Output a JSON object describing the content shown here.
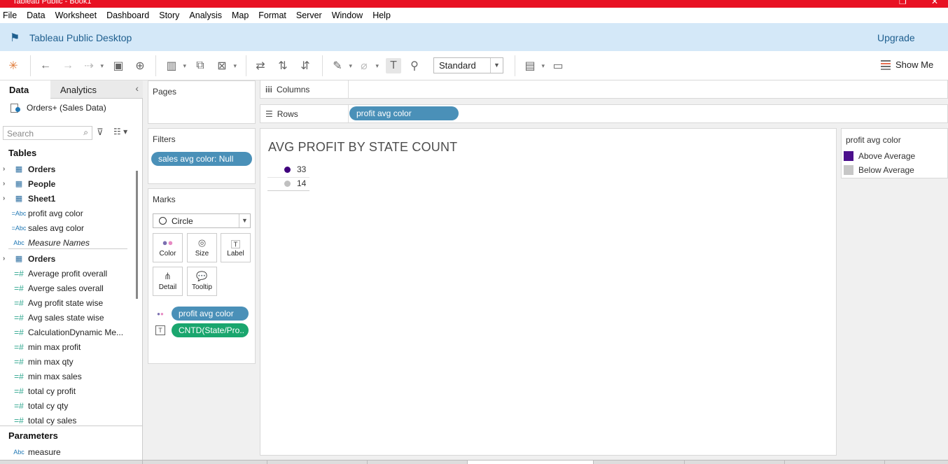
{
  "window": {
    "title": "Tableau Public - Book1"
  },
  "menu": [
    "File",
    "Data",
    "Worksheet",
    "Dashboard",
    "Story",
    "Analysis",
    "Map",
    "Format",
    "Server",
    "Window",
    "Help"
  ],
  "brand": {
    "name": "Tableau Public Desktop",
    "upgrade": "Upgrade"
  },
  "toolbar": {
    "fit_value": "Standard",
    "show_me": "Show Me"
  },
  "data_pane": {
    "tab_data": "Data",
    "tab_analytics": "Analytics",
    "datasource": "Orders+ (Sales Data)",
    "search_placeholder": "Search",
    "tables_heading": "Tables",
    "parameters_heading": "Parameters",
    "items": [
      {
        "label": "Orders",
        "kind": "table"
      },
      {
        "label": "People",
        "kind": "table"
      },
      {
        "label": "Sheet1",
        "kind": "table"
      },
      {
        "label": "profit avg color",
        "kind": "calc-abc"
      },
      {
        "label": "sales avg color",
        "kind": "calc-abc"
      },
      {
        "label": "Measure Names",
        "kind": "abc"
      },
      {
        "label": "Orders",
        "kind": "table"
      },
      {
        "label": "Average profit overall",
        "kind": "calc-num"
      },
      {
        "label": "Averge sales overall",
        "kind": "calc-num"
      },
      {
        "label": "Avg profit state wise",
        "kind": "calc-num"
      },
      {
        "label": "Avg sales state wise",
        "kind": "calc-num"
      },
      {
        "label": "CalculationDynamic Me...",
        "kind": "calc-num"
      },
      {
        "label": "min max  profit",
        "kind": "calc-num"
      },
      {
        "label": "min max  qty",
        "kind": "calc-num"
      },
      {
        "label": "min max sales",
        "kind": "calc-num"
      },
      {
        "label": "total cy profit",
        "kind": "calc-num"
      },
      {
        "label": "total cy qty",
        "kind": "calc-num"
      },
      {
        "label": "total cy sales",
        "kind": "calc-num"
      }
    ],
    "parameter": {
      "label": "measure",
      "kind": "abc"
    }
  },
  "cards": {
    "pages_title": "Pages",
    "filters_title": "Filters",
    "filter_pill": "sales avg color: Null",
    "marks_title": "Marks",
    "mark_type": "Circle",
    "mark_buttons": [
      "Color",
      "Size",
      "Label",
      "Detail",
      "Tooltip"
    ],
    "mark_pills": [
      {
        "label": "profit avg color",
        "encoding": "color"
      },
      {
        "label": "CNTD(State/Pro..",
        "encoding": "label"
      }
    ]
  },
  "shelves": {
    "columns_label": "Columns",
    "rows_label": "Rows",
    "rows_pill": "profit avg color"
  },
  "viz": {
    "title": "AVG PROFIT BY STATE COUNT",
    "marks": [
      {
        "value": "33",
        "color": "#3f007d"
      },
      {
        "value": "14",
        "color": "#c0c0c0"
      }
    ]
  },
  "legend": {
    "title": "profit avg color",
    "items": [
      {
        "label": "Above Average",
        "color": "#4b0f8c"
      },
      {
        "label": "Below Average",
        "color": "#c7c7c7"
      }
    ]
  }
}
